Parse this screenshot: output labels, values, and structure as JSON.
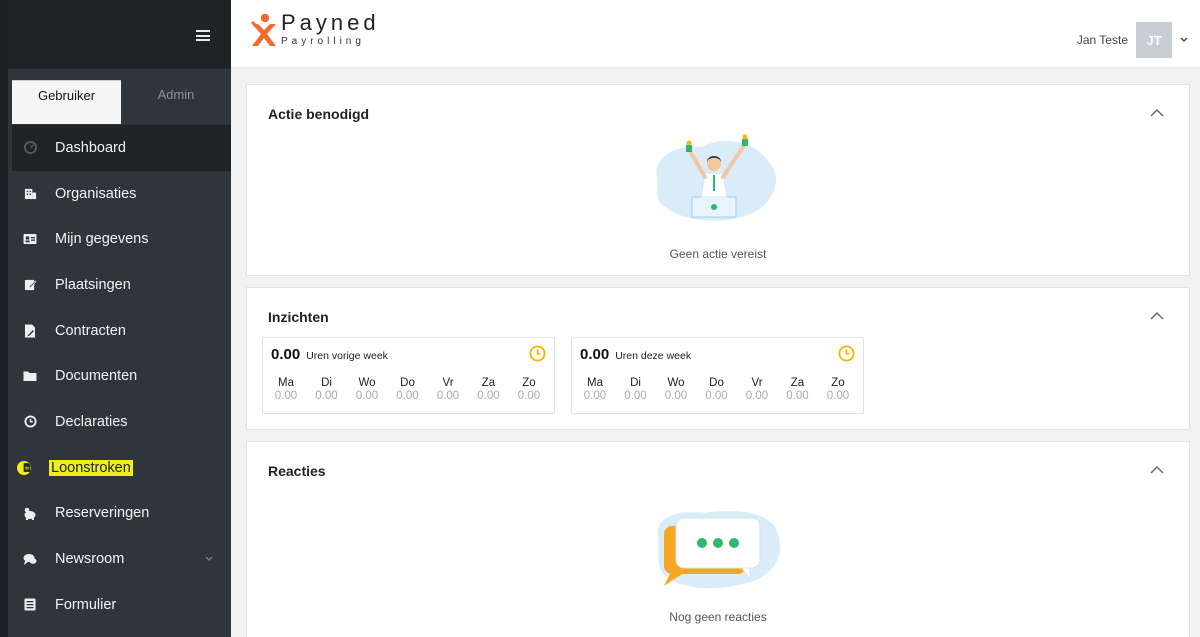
{
  "brand": {
    "title": "Payned",
    "subtitle": "Payrolling"
  },
  "user": {
    "name": "Jan Teste",
    "initials": "JT"
  },
  "sidebar": {
    "tabs": [
      {
        "label": "Gebruiker"
      },
      {
        "label": "Admin"
      }
    ],
    "items": [
      {
        "label": "Dashboard",
        "icon": "dashboard-icon"
      },
      {
        "label": "Organisaties",
        "icon": "building-icon"
      },
      {
        "label": "Mijn gegevens",
        "icon": "id-card-icon"
      },
      {
        "label": "Plaatsingen",
        "icon": "edit-icon"
      },
      {
        "label": "Contracten",
        "icon": "contract-icon"
      },
      {
        "label": "Documenten",
        "icon": "folder-icon"
      },
      {
        "label": "Declaraties",
        "icon": "clock-icon"
      },
      {
        "label": "Loonstroken",
        "icon": "file-icon"
      },
      {
        "label": "Reserveringen",
        "icon": "piggy-bank-icon"
      },
      {
        "label": "Newsroom",
        "icon": "comments-icon"
      },
      {
        "label": "Formulier",
        "icon": "list-icon"
      }
    ]
  },
  "action_card": {
    "title": "Actie benodigd",
    "empty": "Geen actie vereist"
  },
  "insights_card": {
    "title": "Inzichten",
    "weeks": [
      {
        "total": "0.00",
        "label": "Uren vorige week",
        "days": [
          {
            "name": "Ma",
            "value": "0.00"
          },
          {
            "name": "Di",
            "value": "0.00"
          },
          {
            "name": "Wo",
            "value": "0.00"
          },
          {
            "name": "Do",
            "value": "0.00"
          },
          {
            "name": "Vr",
            "value": "0.00"
          },
          {
            "name": "Za",
            "value": "0.00"
          },
          {
            "name": "Zo",
            "value": "0.00"
          }
        ]
      },
      {
        "total": "0.00",
        "label": "Uren deze week",
        "days": [
          {
            "name": "Ma",
            "value": "0.00"
          },
          {
            "name": "Di",
            "value": "0.00"
          },
          {
            "name": "Wo",
            "value": "0.00"
          },
          {
            "name": "Do",
            "value": "0.00"
          },
          {
            "name": "Vr",
            "value": "0.00"
          },
          {
            "name": "Za",
            "value": "0.00"
          },
          {
            "name": "Zo",
            "value": "0.00"
          }
        ]
      }
    ]
  },
  "reactions_card": {
    "title": "Reacties",
    "empty": "Nog geen reacties"
  },
  "colors": {
    "sidebar": "#2f353a",
    "highlight": "#f0ee1b",
    "accent": "#f5b800",
    "logo_orange": "#f26a2e"
  }
}
